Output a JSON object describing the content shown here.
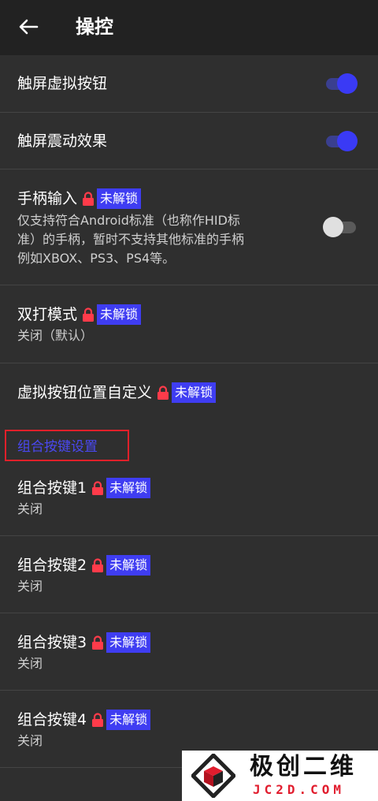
{
  "header": {
    "title": "操控",
    "back_icon": "arrow-left-icon"
  },
  "settings": {
    "touch_buttons": {
      "title": "触屏虚拟按钮",
      "enabled": true
    },
    "touch_vibration": {
      "title": "触屏震动效果",
      "enabled": true
    },
    "gamepad": {
      "title": "手柄输入",
      "badge": "未解锁",
      "desc_line1": "仅支持符合Android标准（也称作HID标",
      "desc_line2": "准）的手柄，暂时不支持其他标准的手柄",
      "desc_line3": "例如XBOX、PS3、PS4等。",
      "enabled": false
    },
    "double_tap": {
      "title": "双打模式",
      "badge": "未解锁",
      "value": "关闭（默认）"
    },
    "custom_layout": {
      "title": "虚拟按钮位置自定义",
      "badge": "未解锁"
    }
  },
  "combo_section": {
    "header": "组合按键设置",
    "items": [
      {
        "title": "组合按键1",
        "badge": "未解锁",
        "value": "关闭"
      },
      {
        "title": "组合按键2",
        "badge": "未解锁",
        "value": "关闭"
      },
      {
        "title": "组合按键3",
        "badge": "未解锁",
        "value": "关闭"
      },
      {
        "title": "组合按键4",
        "badge": "未解锁",
        "value": "关闭"
      }
    ]
  },
  "watermark": {
    "title": "极创二维",
    "subtitle": "JC2D.COM"
  },
  "colors": {
    "accent": "#3a3af5",
    "badge": "#3f3df2",
    "lock": "#ff3b4a",
    "highlight_border": "#e0202a"
  }
}
